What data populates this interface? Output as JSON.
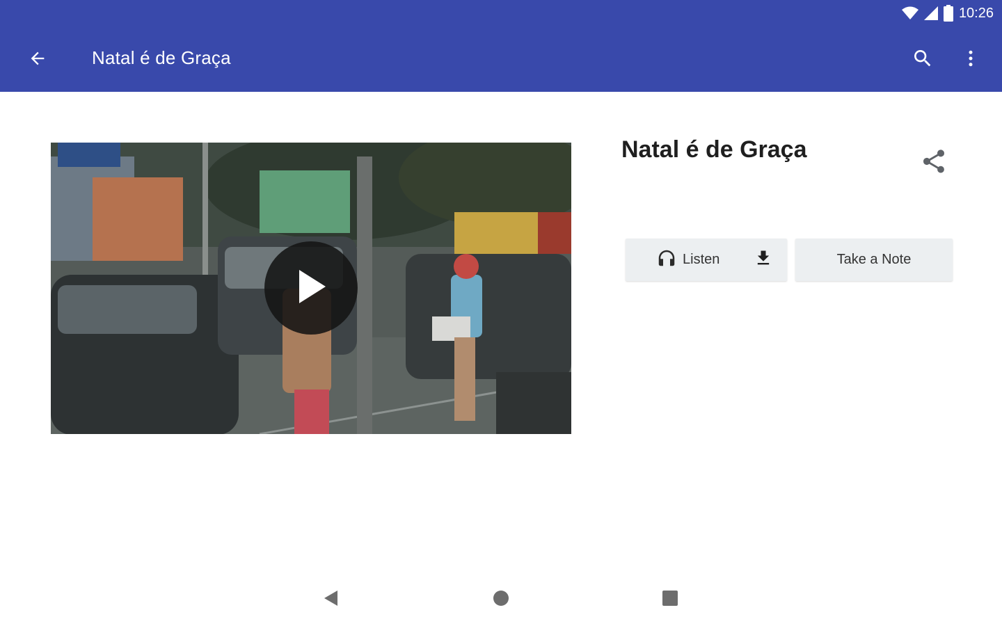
{
  "status_bar": {
    "time": "10:26",
    "icons": [
      "wifi-icon",
      "signal-icon",
      "battery-icon"
    ]
  },
  "toolbar": {
    "title": "Natal é de Graça",
    "back_icon": "arrow-back-icon",
    "search_icon": "search-icon",
    "more_icon": "more-vert-icon",
    "background_color": "#3949ab"
  },
  "video": {
    "play_icon": "play-icon"
  },
  "content": {
    "title": "Natal é de Graça",
    "share_icon": "share-icon",
    "listen_label": "Listen",
    "listen_icon": "headphones-icon",
    "download_icon": "download-icon",
    "note_label": "Take a Note"
  },
  "nav_bar": {
    "back_icon": "nav-back-icon",
    "home_icon": "nav-home-icon",
    "recents_icon": "nav-recents-icon"
  }
}
